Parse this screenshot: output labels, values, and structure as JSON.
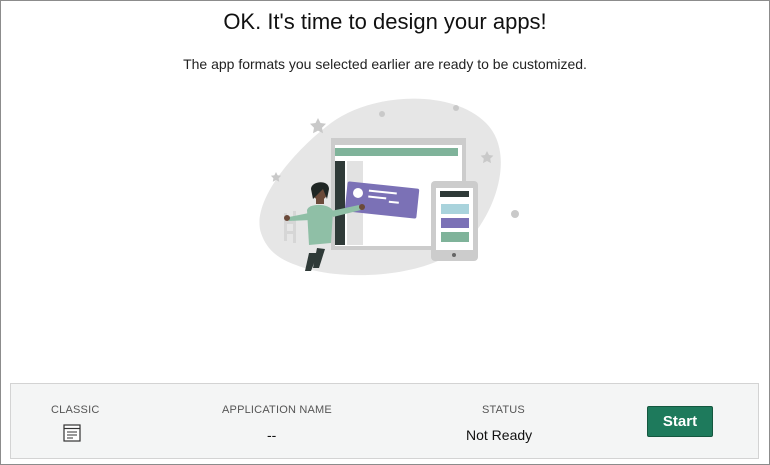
{
  "header": {
    "title": "OK. It's time to design your apps!",
    "subtitle": "The app formats you selected earlier are ready to be customized."
  },
  "app_table": {
    "format_label": "CLASSIC",
    "format_icon": "document-list-icon",
    "name_label": "APPLICATION NAME",
    "name_value": "--",
    "status_label": "STATUS",
    "status_value": "Not Ready",
    "start_button": "Start"
  },
  "colors": {
    "accent": "#1e7a5c",
    "illustration_purple": "#7b71b6",
    "illustration_green": "#7fb39a"
  }
}
